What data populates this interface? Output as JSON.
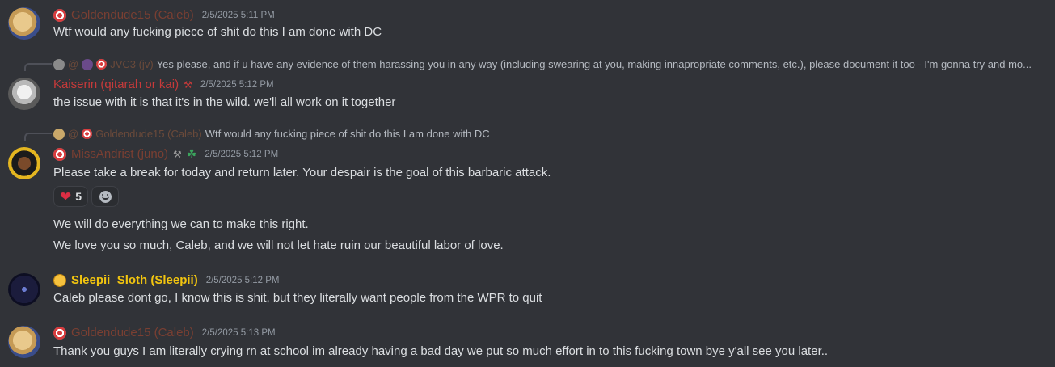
{
  "colors": {
    "background": "#313338",
    "text": "#dbdee1",
    "timestamp": "#949ba4",
    "golden_name": "#7a3f32",
    "kai_name": "#c73a3a",
    "sloth_name": "#f1c40f"
  },
  "messages": [
    {
      "author": "Goldendude15 (Caleb)",
      "timestamp": "2/5/2025 5:11 PM",
      "text": "Wtf would any fucking piece of shit do this I am done with DC"
    },
    {
      "reply": {
        "at": "@",
        "author": "JVC3 (jv)",
        "text": "Yes please, and if u have any evidence of them harassing you in any way (including swearing at you, making innapropriate comments, etc.), please document it too - I'm gonna try and mo..."
      },
      "author": "Kaiserin (qitarah or kai)",
      "timestamp": "2/5/2025 5:12 PM",
      "text": "the issue with it is that it's in the wild. we'll all work on it together"
    },
    {
      "reply": {
        "at": "@",
        "author": "Goldendude15 (Caleb)",
        "text": "Wtf would any fucking piece of shit do this I am done with DC"
      },
      "author": "MissAndrist (juno)",
      "timestamp": "2/5/2025 5:12 PM",
      "text": "Please take a break for today and return later. Your despair is the goal of this barbaric attack.",
      "reactions": [
        {
          "emoji": "heart-emoji",
          "count": "5"
        }
      ],
      "followups": [
        "We will do everything we can to make this right.",
        "We love you so much, Caleb, and we will not let hate ruin our beautiful labor of love."
      ]
    },
    {
      "author": "Sleepii_Sloth (Sleepii)",
      "timestamp": "2/5/2025 5:12 PM",
      "text": "Caleb please dont go, I know this is shit, but they literally want people from the WPR to quit"
    },
    {
      "author": "Goldendude15 (Caleb)",
      "timestamp": "2/5/2025 5:13 PM",
      "text": "Thank you guys I am literally crying rn at school im already having a bad day we put so much effort in to this fucking town bye y'all see you later.."
    }
  ]
}
